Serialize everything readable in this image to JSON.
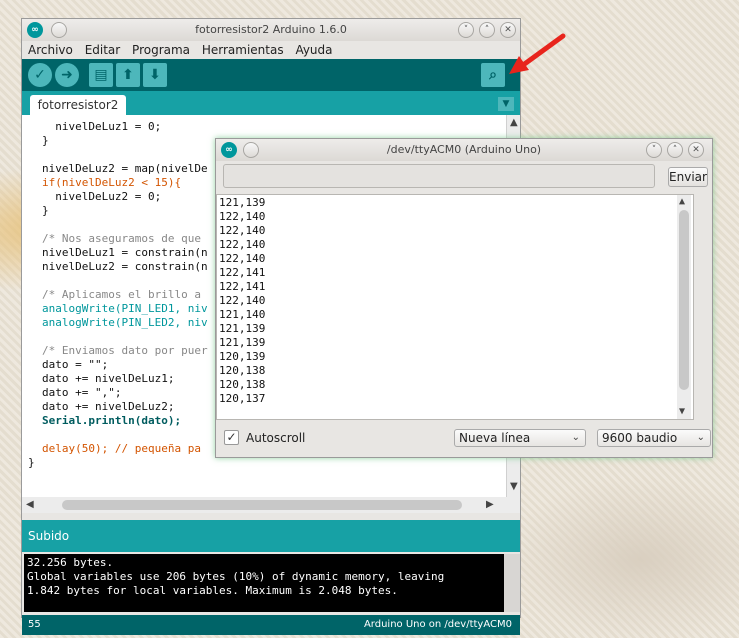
{
  "ide": {
    "title": "fotorresistor2 Arduino 1.6.0",
    "menu": [
      "Archivo",
      "Editar",
      "Programa",
      "Herramientas",
      "Ayuda"
    ],
    "tab": "fotorresistor2",
    "code": [
      "  nivelDeLuz1 = 0;",
      "}",
      "",
      "nivelDeLuz2 = map(nivelDe",
      "if(nivelDeLuz2 < 15){",
      "  nivelDeLuz2 = 0;",
      "}",
      "",
      "/* Nos aseguramos de que",
      "nivelDeLuz1 = constrain(n",
      "nivelDeLuz2 = constrain(n",
      "",
      "/* Aplicamos el brillo a",
      "analogWrite(PIN_LED1, niv",
      "analogWrite(PIN_LED2, niv",
      "",
      "/* Enviamos dato por puer",
      "dato = \"\";",
      "dato += nivelDeLuz1;",
      "dato += \",\";",
      "dato += nivelDeLuz2;",
      "Serial.println(dato);",
      "",
      "delay(50); // pequeña pa",
      "}"
    ],
    "status_message": "Subido",
    "console": [
      "32.256 bytes.",
      "Global variables use 206 bytes (10%) of dynamic memory, leaving",
      "1.842 bytes for local variables. Maximum is 2.048 bytes."
    ],
    "line_number": "55",
    "board_port": "Arduino Uno on /dev/ttyACM0"
  },
  "serial": {
    "title": "/dev/ttyACM0 (Arduino Uno)",
    "send_label": "Enviar",
    "input_value": "",
    "output": [
      "121,139",
      "122,140",
      "122,140",
      "122,140",
      "122,140",
      "122,141",
      "122,141",
      "122,140",
      "121,140",
      "121,139",
      "121,139",
      "120,139",
      "120,138",
      "120,138",
      "120,137"
    ],
    "autoscroll_label": "Autoscroll",
    "autoscroll_checked": true,
    "line_ending": "Nueva línea",
    "baud": "9600 baudio"
  },
  "colors": {
    "teal_dark": "#006468",
    "teal_light": "#17a1a5",
    "annotation_arrow": "#e8241c"
  },
  "icons": {
    "verify": "check-icon",
    "upload": "arrow-right-icon",
    "new": "new-file-icon",
    "open": "arrow-up-icon",
    "save": "arrow-down-icon",
    "serial_monitor": "magnifier-icon"
  }
}
